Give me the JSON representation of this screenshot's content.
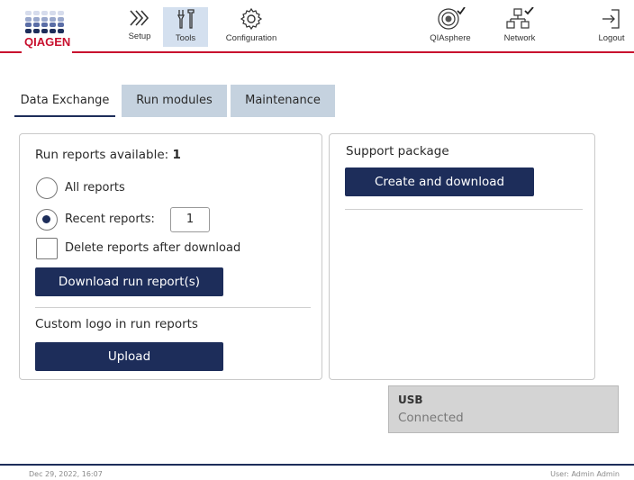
{
  "header": {
    "logo_text": "QIAGEN",
    "nav": [
      {
        "label": "Setup",
        "icon": "chevrons-right-icon"
      },
      {
        "label": "Tools",
        "icon": "tools-icon",
        "active": true
      },
      {
        "label": "Configuration",
        "icon": "gear-icon"
      },
      {
        "label": "QIAsphere",
        "icon": "qiasphere-icon"
      },
      {
        "label": "Network",
        "icon": "network-icon"
      },
      {
        "label": "Logout",
        "icon": "logout-icon"
      }
    ],
    "accent_color": "#c8102e"
  },
  "tabs": [
    {
      "label": "Data Exchange",
      "active": true
    },
    {
      "label": "Run modules",
      "active": false
    },
    {
      "label": "Maintenance",
      "active": false
    }
  ],
  "run_reports": {
    "heading": "Run reports available:",
    "count": "1",
    "all_reports_label": "All reports",
    "recent_reports_label": "Recent reports:",
    "recent_reports_value": "1",
    "selected": "recent",
    "delete_label": "Delete reports after download",
    "delete_checked": false,
    "download_button": "Download run report(s)"
  },
  "custom_logo": {
    "heading": "Custom logo in run reports",
    "upload_button": "Upload"
  },
  "support": {
    "heading": "Support package",
    "create_button": "Create and download"
  },
  "usb": {
    "title": "USB",
    "status": "Connected"
  },
  "footer": {
    "datetime": "Dec 29, 2022,  16:07",
    "user": "User: Admin Admin"
  },
  "colors": {
    "primary": "#1d2d5a",
    "tab_inactive": "#c5d2df",
    "nav_active": "#d4e0ef"
  }
}
